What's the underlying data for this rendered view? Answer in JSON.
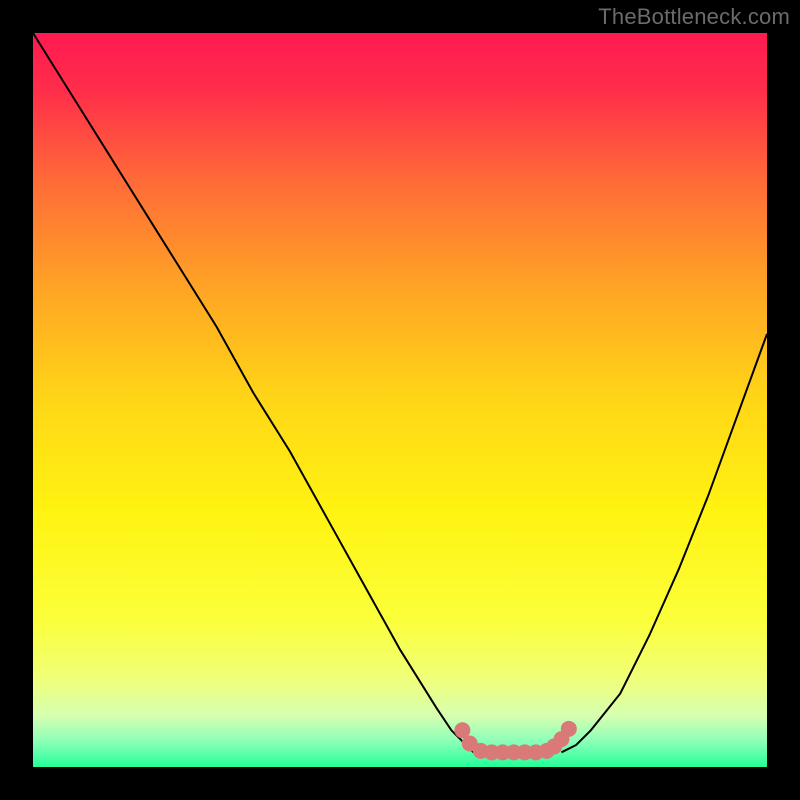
{
  "watermark": "TheBottleneck.com",
  "chart_data": {
    "type": "line",
    "title": "",
    "xlabel": "",
    "ylabel": "",
    "xlim": [
      0,
      100
    ],
    "ylim": [
      0,
      100
    ],
    "gradient_stops": [
      {
        "offset": 0,
        "color": "#ff1a51"
      },
      {
        "offset": 0.08,
        "color": "#ff2e4a"
      },
      {
        "offset": 0.2,
        "color": "#ff6a38"
      },
      {
        "offset": 0.35,
        "color": "#ffa524"
      },
      {
        "offset": 0.5,
        "color": "#ffd617"
      },
      {
        "offset": 0.65,
        "color": "#fff311"
      },
      {
        "offset": 0.8,
        "color": "#fbff3a"
      },
      {
        "offset": 0.88,
        "color": "#f0ff7a"
      },
      {
        "offset": 0.93,
        "color": "#d6ffb0"
      },
      {
        "offset": 0.965,
        "color": "#8cffb8"
      },
      {
        "offset": 1.0,
        "color": "#23ff9a"
      }
    ],
    "series": [
      {
        "name": "left-curve",
        "stroke": "#000000",
        "x": [
          0,
          5,
          10,
          15,
          20,
          25,
          30,
          35,
          40,
          45,
          50,
          55,
          57,
          59,
          60
        ],
        "y": [
          100,
          92,
          84,
          76,
          68,
          60,
          51,
          43,
          34,
          25,
          16,
          8,
          5,
          3,
          2
        ]
      },
      {
        "name": "right-curve",
        "stroke": "#000000",
        "x": [
          72,
          74,
          76,
          80,
          84,
          88,
          92,
          96,
          100
        ],
        "y": [
          2,
          3,
          5,
          10,
          18,
          27,
          37,
          48,
          59
        ]
      },
      {
        "name": "valley-band",
        "stroke": "#d97a78",
        "x": [
          57,
          58.5,
          60,
          62,
          64,
          66,
          68,
          70,
          71.5,
          73,
          74
        ],
        "y": [
          6,
          4,
          2.5,
          2,
          2,
          2,
          2,
          2.2,
          3,
          4.5,
          6
        ]
      }
    ],
    "valley_dots": {
      "color": "#d97a78",
      "points": [
        {
          "x": 58.5,
          "y": 5.0
        },
        {
          "x": 59.5,
          "y": 3.2
        },
        {
          "x": 61.0,
          "y": 2.2
        },
        {
          "x": 62.5,
          "y": 2.0
        },
        {
          "x": 64.0,
          "y": 2.0
        },
        {
          "x": 65.5,
          "y": 2.0
        },
        {
          "x": 67.0,
          "y": 2.0
        },
        {
          "x": 68.5,
          "y": 2.0
        },
        {
          "x": 70.0,
          "y": 2.2
        },
        {
          "x": 71.0,
          "y": 2.8
        },
        {
          "x": 72.0,
          "y": 3.8
        },
        {
          "x": 73.0,
          "y": 5.2
        }
      ]
    }
  }
}
